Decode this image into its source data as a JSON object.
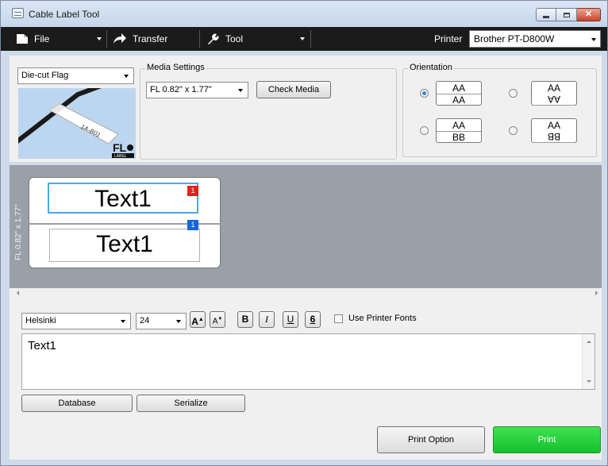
{
  "window": {
    "title": "Cable Label Tool"
  },
  "toolbar": {
    "file_label": "File",
    "transfer_label": "Transfer",
    "tool_label": "Tool",
    "printer_label": "Printer",
    "printer_value": "Brother PT-D800W"
  },
  "settings": {
    "label_type": "Die-cut Flag",
    "media_group_label": "Media Settings",
    "media_value": "FL 0.82\" x 1.77\"",
    "check_media_label": "Check Media",
    "orientation_label": "Orientation",
    "orientation_options": [
      {
        "top": "AA",
        "bottom": "AA",
        "checked": true
      },
      {
        "top": "AA",
        "bottom": "AA",
        "checked": false,
        "bottom_flipped": true
      },
      {
        "top": "AA",
        "bottom": "BB",
        "checked": false
      },
      {
        "top": "AA",
        "bottom": "BB",
        "checked": false,
        "bottom_flipped": true
      }
    ],
    "media_image_text": "1A-B01",
    "media_logo_text": "FL",
    "media_logo_sub": "LABEL"
  },
  "canvas": {
    "side_label": "FL 0.82\" x 1.77\"",
    "field1_text": "Text1",
    "field1_badge": "1",
    "field2_text": "Text1",
    "field2_badge": "1",
    "badge_red": "#e3201a",
    "badge_blue": "#1565d8"
  },
  "editor": {
    "font": "Helsinki",
    "size": "24",
    "grow_label": "A",
    "shrink_label": "A",
    "bold_label": "B",
    "italic_label": "I",
    "underline_label": "U",
    "frame_label": "6",
    "use_printer_fonts": "Use Printer Fonts",
    "text_value": "Text1",
    "database_label": "Database",
    "serialize_label": "Serialize",
    "print_option_label": "Print Option",
    "print_label": "Print",
    "print_color": "#17c02c"
  }
}
